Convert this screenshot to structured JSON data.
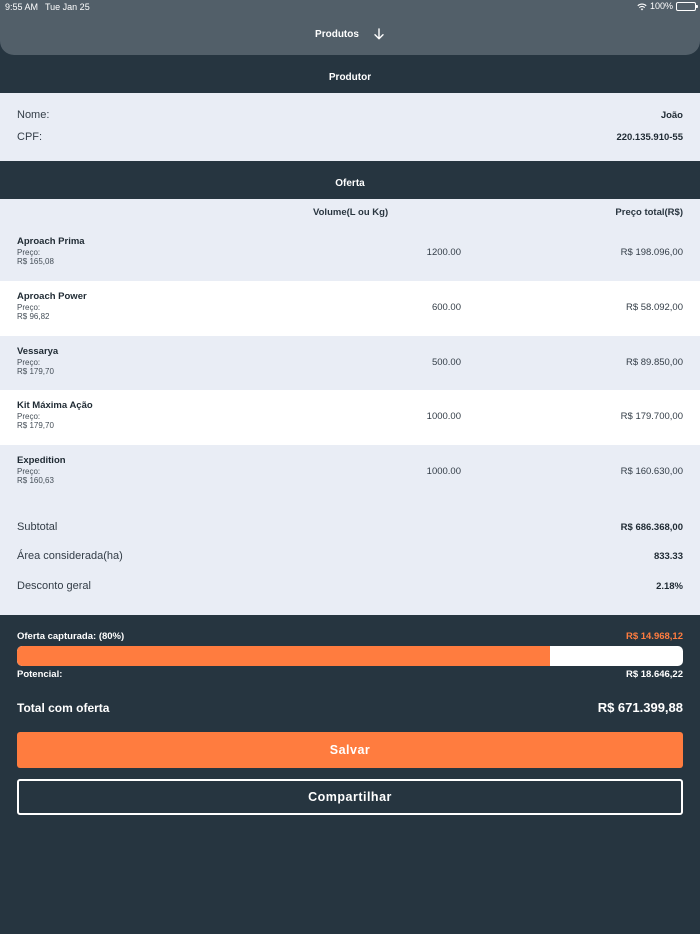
{
  "status_bar": {
    "time": "9:55 AM",
    "date": "Tue Jan 25",
    "battery": "100%"
  },
  "header": {
    "title": "Produtos",
    "icon": "arrow-down-icon"
  },
  "produtor": {
    "section_title": "Produtor",
    "nome_label": "Nome:",
    "nome_value": "João",
    "cpf_label": "CPF:",
    "cpf_value": "220.135.910-55"
  },
  "oferta": {
    "section_title": "Oferta",
    "col_volume": "Volume(L ou Kg)",
    "col_total": "Preço total(R$)",
    "price_label": "Preço:",
    "items": [
      {
        "name": "Aproach Prima",
        "price": "R$ 165,08",
        "volume": "1200.00",
        "total": "R$ 198.096,00"
      },
      {
        "name": "Aproach Power",
        "price": "R$ 96,82",
        "volume": "600.00",
        "total": "R$ 58.092,00"
      },
      {
        "name": "Vessarya",
        "price": "R$ 179,70",
        "volume": "500.00",
        "total": "R$ 89.850,00"
      },
      {
        "name": "Kit Máxima Ação",
        "price": "R$ 179,70",
        "volume": "1000.00",
        "total": "R$ 179.700,00"
      },
      {
        "name": "Expedition",
        "price": "R$ 160,63",
        "volume": "1000.00",
        "total": "R$ 160.630,00"
      }
    ]
  },
  "summary": {
    "subtotal_label": "Subtotal",
    "subtotal_value": "R$ 686.368,00",
    "area_label": "Área considerada(ha)",
    "area_value": "833.33",
    "desconto_label": "Desconto geral",
    "desconto_value": "2.18%"
  },
  "capture": {
    "label": "Oferta capturada: (80%)",
    "value": "R$ 14.968,12",
    "progress_percent": 80,
    "potential_label": "Potencial:",
    "potential_value": "R$ 18.646,22"
  },
  "total": {
    "label": "Total com oferta",
    "value": "R$ 671.399,88"
  },
  "buttons": {
    "save": "Salvar",
    "share": "Compartilhar"
  },
  "colors": {
    "accent": "#ff7c3f",
    "dark_bg": "#263540",
    "light_bg": "#e9edf5",
    "header_bg": "#525f69"
  }
}
